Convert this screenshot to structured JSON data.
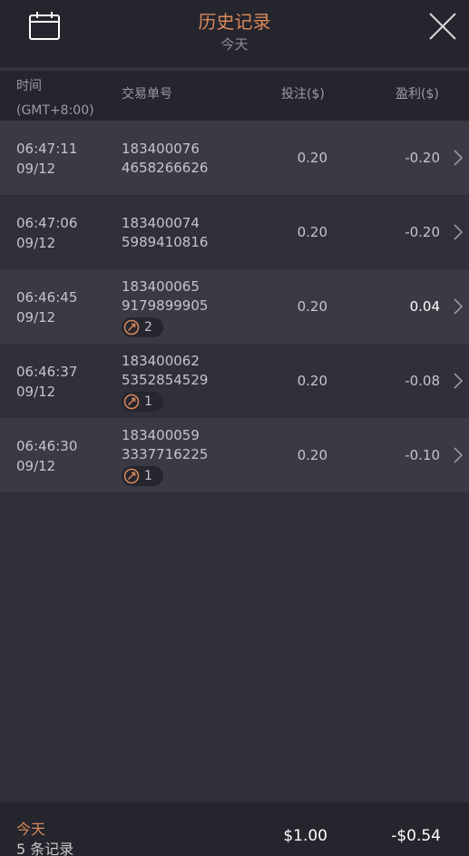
{
  "header": {
    "title": "历史记录",
    "subtitle": "今天"
  },
  "columns": {
    "time": "时间",
    "time_zone": "(GMT+8:00)",
    "order_no": "交易单号",
    "bet": "投注($)",
    "profit": "盈利($)"
  },
  "rows": [
    {
      "time": "06:47:11",
      "date": "09/12",
      "order_a": "183400076",
      "order_b": "4658266626",
      "bet": "0.20",
      "profit": "-0.20",
      "badge": null
    },
    {
      "time": "06:47:06",
      "date": "09/12",
      "order_a": "183400074",
      "order_b": "5989410816",
      "bet": "0.20",
      "profit": "-0.20",
      "badge": null
    },
    {
      "time": "06:46:45",
      "date": "09/12",
      "order_a": "183400065",
      "order_b": "9179899905",
      "bet": "0.20",
      "profit": "0.04",
      "badge": "2"
    },
    {
      "time": "06:46:37",
      "date": "09/12",
      "order_a": "183400062",
      "order_b": "5352854529",
      "bet": "0.20",
      "profit": "-0.08",
      "badge": "1"
    },
    {
      "time": "06:46:30",
      "date": "09/12",
      "order_a": "183400059",
      "order_b": "3337716225",
      "bet": "0.20",
      "profit": "-0.10",
      "badge": "1"
    }
  ],
  "footer": {
    "label": "今天",
    "count": "5 条记录",
    "total_bet": "$1.00",
    "total_profit": "-$0.54"
  },
  "colors": {
    "accent": "#d9895a",
    "background": "#30303a",
    "header_bg": "#25252d",
    "row_alt": "#3a3a44"
  },
  "icons": {
    "calendar": "calendar-icon",
    "close": "close-icon",
    "row_chevron": "chevron-right-icon",
    "badge": "free-spin-icon"
  }
}
